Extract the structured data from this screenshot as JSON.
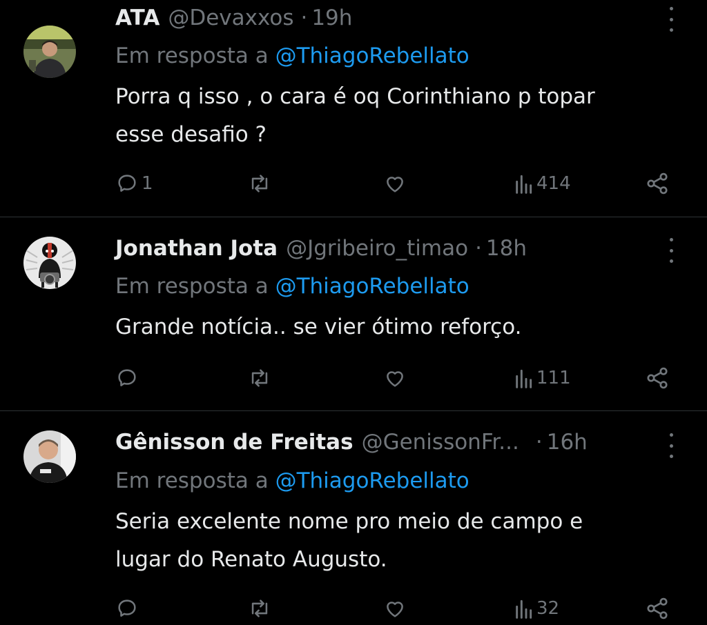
{
  "replies": [
    {
      "name": "ATA",
      "handle": "@Devaxxos",
      "separator": "·",
      "time": "19h",
      "in_reply_label": "Em resposta a",
      "in_reply_mention": "@ThiagoRebellato",
      "text_lines": [
        "Porra q isso , o cara é oq Corinthiano p topar",
        "esse desafio ?"
      ],
      "reply_count": "1",
      "repost_count": "",
      "like_count": "",
      "views": "414",
      "avatar_icon": "profile-photo"
    },
    {
      "name": "Jonathan Jota",
      "handle": "@Jgribeiro_timao",
      "separator": "·",
      "time": "18h",
      "in_reply_label": "Em resposta a",
      "in_reply_mention": "@ThiagoRebellato",
      "text_lines": [
        "Grande notícia.. se vier ótimo reforço."
      ],
      "reply_count": "",
      "repost_count": "",
      "like_count": "",
      "views": "111",
      "avatar_icon": "skull-rider-avatar"
    },
    {
      "name": "Gênisson de Freitas",
      "handle": "@GenissonFr...",
      "separator": "·",
      "time": "16h",
      "in_reply_label": "Em resposta a",
      "in_reply_mention": "@ThiagoRebellato",
      "text_lines": [
        "Seria excelente nome pro meio de campo e",
        "lugar do Renato Augusto."
      ],
      "reply_count": "",
      "repost_count": "",
      "like_count": "",
      "views": "32",
      "avatar_icon": "profile-photo"
    }
  ],
  "colors": {
    "background": "#000000",
    "primary_text": "#e7e9ea",
    "secondary_text": "#71767b",
    "link": "#1d9bf0",
    "divider": "#2f3336"
  },
  "icons": {
    "reply": "reply-icon",
    "repost": "repost-icon",
    "like": "heart-icon",
    "views": "views-chart-icon",
    "share": "share-icon",
    "more": "more-options-icon"
  }
}
